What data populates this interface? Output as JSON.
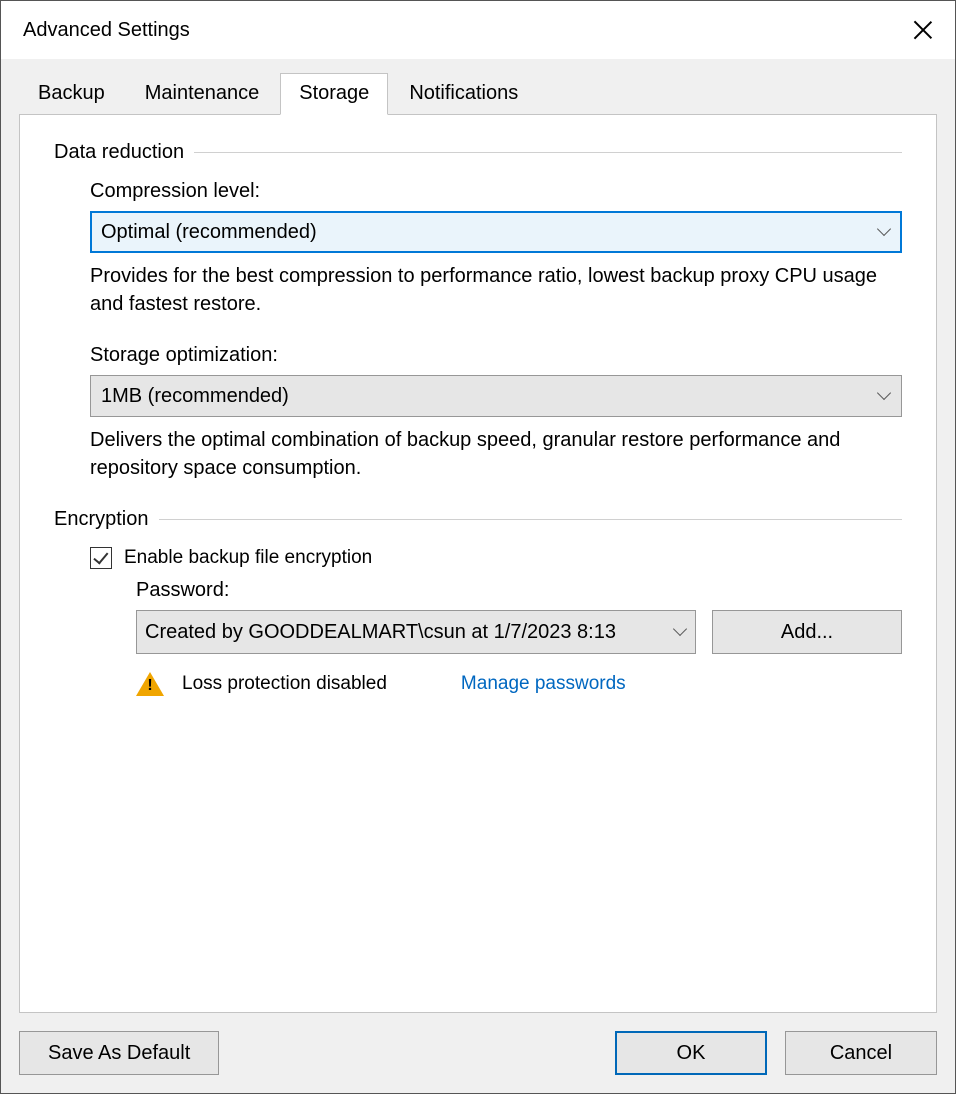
{
  "title": "Advanced Settings",
  "tabs": {
    "backup": "Backup",
    "maintenance": "Maintenance",
    "storage": "Storage",
    "notifications": "Notifications"
  },
  "groups": {
    "data_reduction": "Data reduction",
    "encryption": "Encryption"
  },
  "compression": {
    "label": "Compression level:",
    "value": "Optimal (recommended)",
    "desc": "Provides for the best compression to performance ratio, lowest backup proxy CPU usage and fastest restore."
  },
  "storage_opt": {
    "label": "Storage optimization:",
    "value": "1MB (recommended)",
    "desc": "Delivers the optimal combination of backup speed, granular restore performance and repository space consumption."
  },
  "encryption": {
    "checkbox_label": "Enable backup file encryption",
    "password_label": "Password:",
    "password_value": "Created by GOODDEALMART\\csun at 1/7/2023 8:13 ",
    "add_button": "Add...",
    "warning_text": "Loss protection disabled",
    "manage_link": "Manage passwords"
  },
  "buttons": {
    "save_default": "Save As Default",
    "ok": "OK",
    "cancel": "Cancel"
  }
}
